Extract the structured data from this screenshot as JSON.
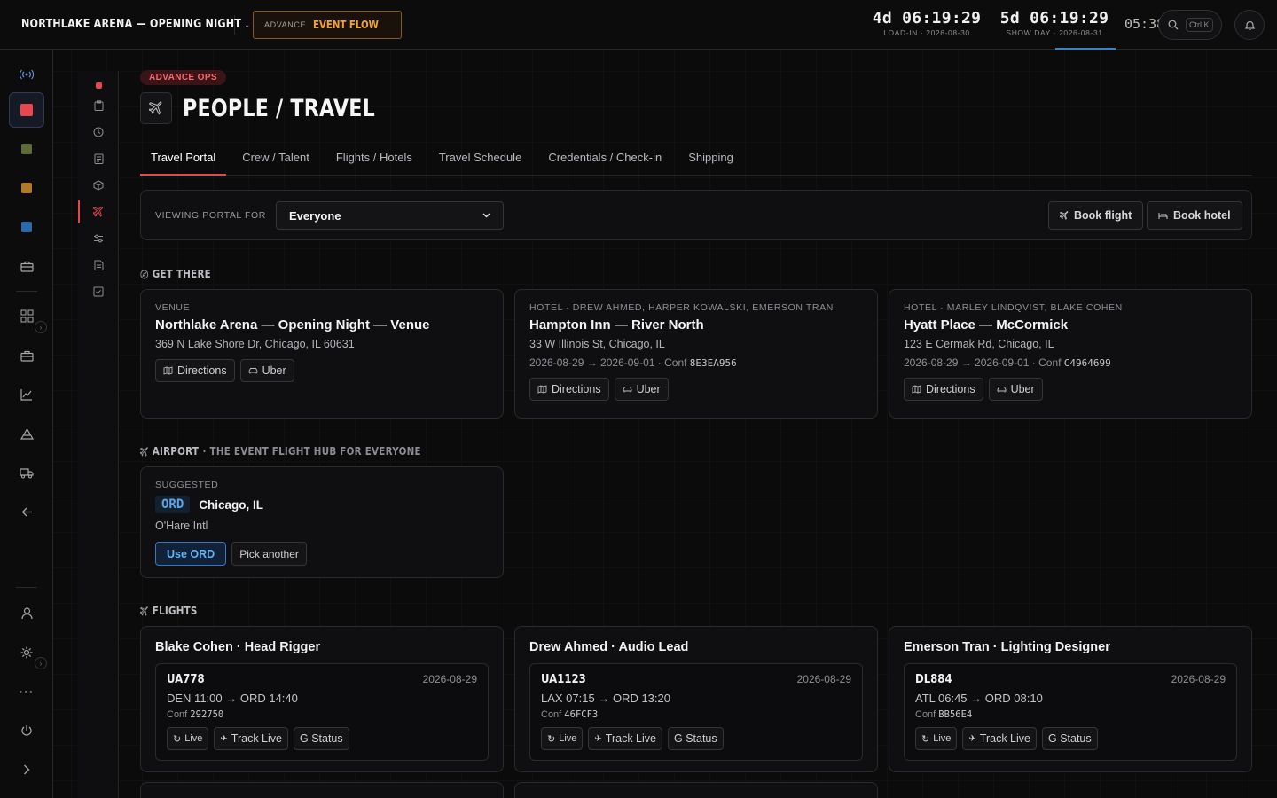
{
  "header": {
    "app_title": "NORTHLAKE ARENA — OPENING NIGHT",
    "flow_small": "ADVANCE",
    "flow_big": "EVENT FLOW",
    "countdowns": [
      {
        "value": "4d 06:19:29",
        "label": "LOAD-IN · 2026-08-30"
      },
      {
        "value": "5d 06:19:29",
        "label": "SHOW DAY · 2026-08-31"
      }
    ],
    "clock": "05:38",
    "search_shortcut": "Ctrl K"
  },
  "page": {
    "badge": "ADVANCE OPS",
    "title": "PEOPLE / TRAVEL"
  },
  "tabs": [
    "Travel Portal",
    "Crew / Talent",
    "Flights / Hotels",
    "Travel Schedule",
    "Credentials / Check-in",
    "Shipping"
  ],
  "portal": {
    "label": "VIEWING PORTAL FOR",
    "selected": "Everyone",
    "book_flight": "Book flight",
    "book_hotel": "Book hotel"
  },
  "get_there": {
    "heading": "GET THERE",
    "cards": [
      {
        "kicker": "VENUE",
        "title": "Northlake Arena — Opening Night — Venue",
        "address": "369 N Lake Shore Dr, Chicago, IL 60631",
        "dates": "",
        "conf": "",
        "directions": "Directions",
        "uber": "Uber"
      },
      {
        "kicker": "HOTEL · DREW AHMED, HARPER KOWALSKI, EMERSON TRAN",
        "title": "Hampton Inn — River North",
        "address": "33 W Illinois St, Chicago, IL",
        "dates": "2026-08-29 → 2026-09-01 · Conf ",
        "conf": "8E3EA956",
        "directions": "Directions",
        "uber": "Uber"
      },
      {
        "kicker": "HOTEL · MARLEY LINDQVIST, BLAKE COHEN",
        "title": "Hyatt Place — McCormick",
        "address": "123 E Cermak Rd, Chicago, IL",
        "dates": "2026-08-29 → 2026-09-01 · Conf ",
        "conf": "C4964699",
        "directions": "Directions",
        "uber": "Uber"
      }
    ]
  },
  "airport": {
    "heading": "AIRPORT",
    "heading_sub": "· THE EVENT FLIGHT HUB FOR EVERYONE",
    "kicker": "SUGGESTED",
    "code": "ORD",
    "city": "Chicago, IL",
    "name": "O'Hare Intl",
    "use_label": "Use ORD",
    "pick_label": "Pick another"
  },
  "flights": {
    "heading": "FLIGHTS",
    "items": [
      {
        "person": "Blake Cohen · Head Rigger",
        "flight": "UA778",
        "date": "2026-08-29",
        "route": "DEN 11:00 → ORD 14:40",
        "conf_label": "Conf ",
        "conf": "292750",
        "live": "Live",
        "track": "Track Live",
        "status": "G Status"
      },
      {
        "person": "Drew Ahmed · Audio Lead",
        "flight": "UA1123",
        "date": "2026-08-29",
        "route": "LAX 07:15 → ORD 13:20",
        "conf_label": "Conf ",
        "conf": "46FCF3",
        "live": "Live",
        "track": "Track Live",
        "status": "G Status"
      },
      {
        "person": "Emerson Tran · Lighting Designer",
        "flight": "DL884",
        "date": "2026-08-29",
        "route": "ATL 06:45 → ORD 08:10",
        "conf_label": "Conf ",
        "conf": "BB56E4",
        "live": "Live",
        "track": "Track Live",
        "status": "G Status"
      }
    ]
  },
  "colors": {
    "accent_red": "#e4474f",
    "accent_orange": "#f2a134",
    "accent_blue": "#5aa6e8",
    "rail_red": "#e8474f",
    "rail_olive": "#5f6b3a",
    "rail_amber": "#b07a2a",
    "rail_blue": "#2f6aa8"
  },
  "icons": {
    "rail": [
      "broadcast-icon",
      "red-project-icon",
      "olive-project-icon",
      "amber-project-icon",
      "blue-project-icon",
      "briefcase-icon",
      "grid-icon",
      "toolbox-icon",
      "chart-icon",
      "tent-icon",
      "truck-icon",
      "arrow-left-icon",
      "user-icon",
      "settings-icon",
      "more-icon",
      "power-icon",
      "chevron-right-icon"
    ],
    "subrail": [
      "dot-icon",
      "clipboard-icon",
      "clock-icon",
      "document-icon",
      "cube-icon",
      "plane-icon",
      "sliders-icon",
      "file-icon",
      "checklist-icon"
    ]
  }
}
